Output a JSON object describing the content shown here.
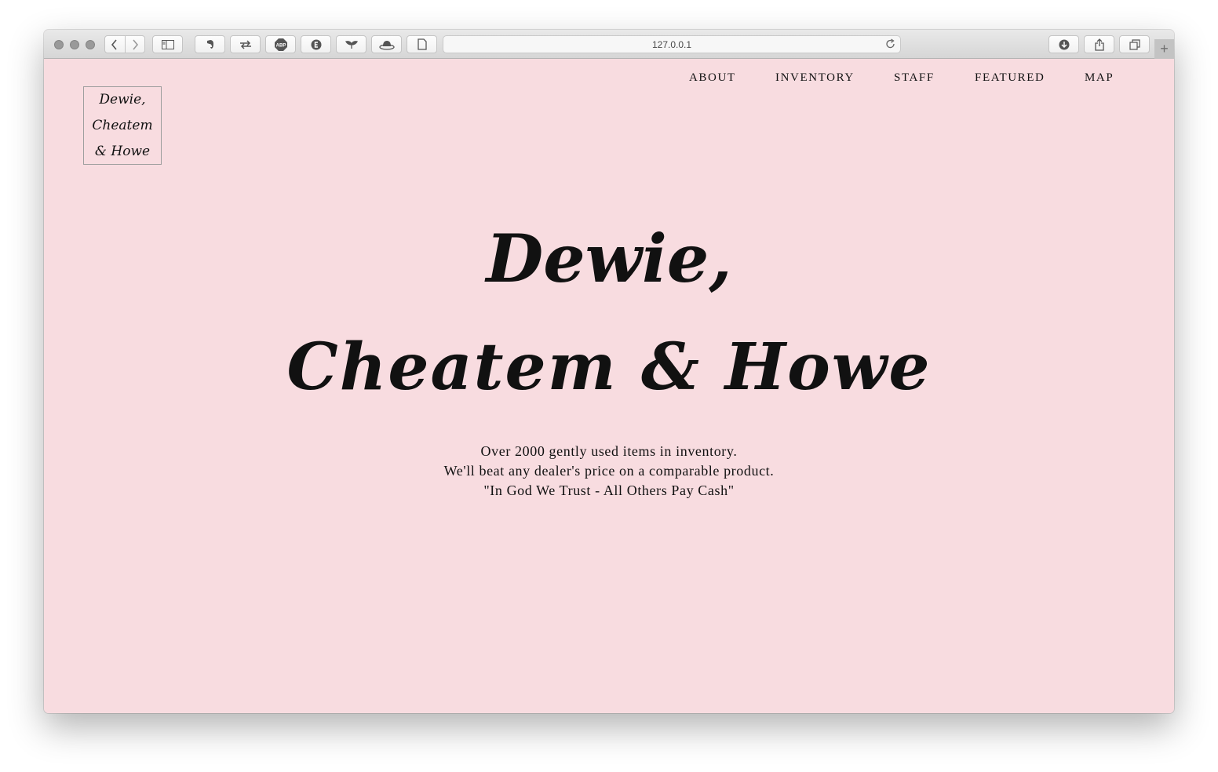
{
  "browser": {
    "address": "127.0.0.1",
    "new_tab_label": "+",
    "toolbar_icons": [
      "back-icon",
      "forward-icon",
      "sidebar-icon",
      "evernote-icon",
      "transfer-icon",
      "adblock-icon",
      "evernote-e-icon",
      "plant-icon",
      "hat-icon",
      "page-icon",
      "reload-icon",
      "download-icon",
      "share-icon",
      "tabs-icon"
    ],
    "adblock_label": "ABP"
  },
  "logo": {
    "line1": "Dewie,",
    "line2": "Cheatem",
    "line3": "& Howe"
  },
  "nav": {
    "items": [
      "ABOUT",
      "INVENTORY",
      "STAFF",
      "FEATURED",
      "MAP"
    ]
  },
  "hero": {
    "line1": "Dewie,",
    "line2": "Cheatem & Howe"
  },
  "tagline": {
    "line1": "Over 2000 gently used items in inventory.",
    "line2": "We'll beat any dealer's price on a comparable product.",
    "line3": "\"In God We Trust - All Others Pay Cash\""
  },
  "colors": {
    "page_background": "#f8dce0",
    "text": "#111111"
  }
}
